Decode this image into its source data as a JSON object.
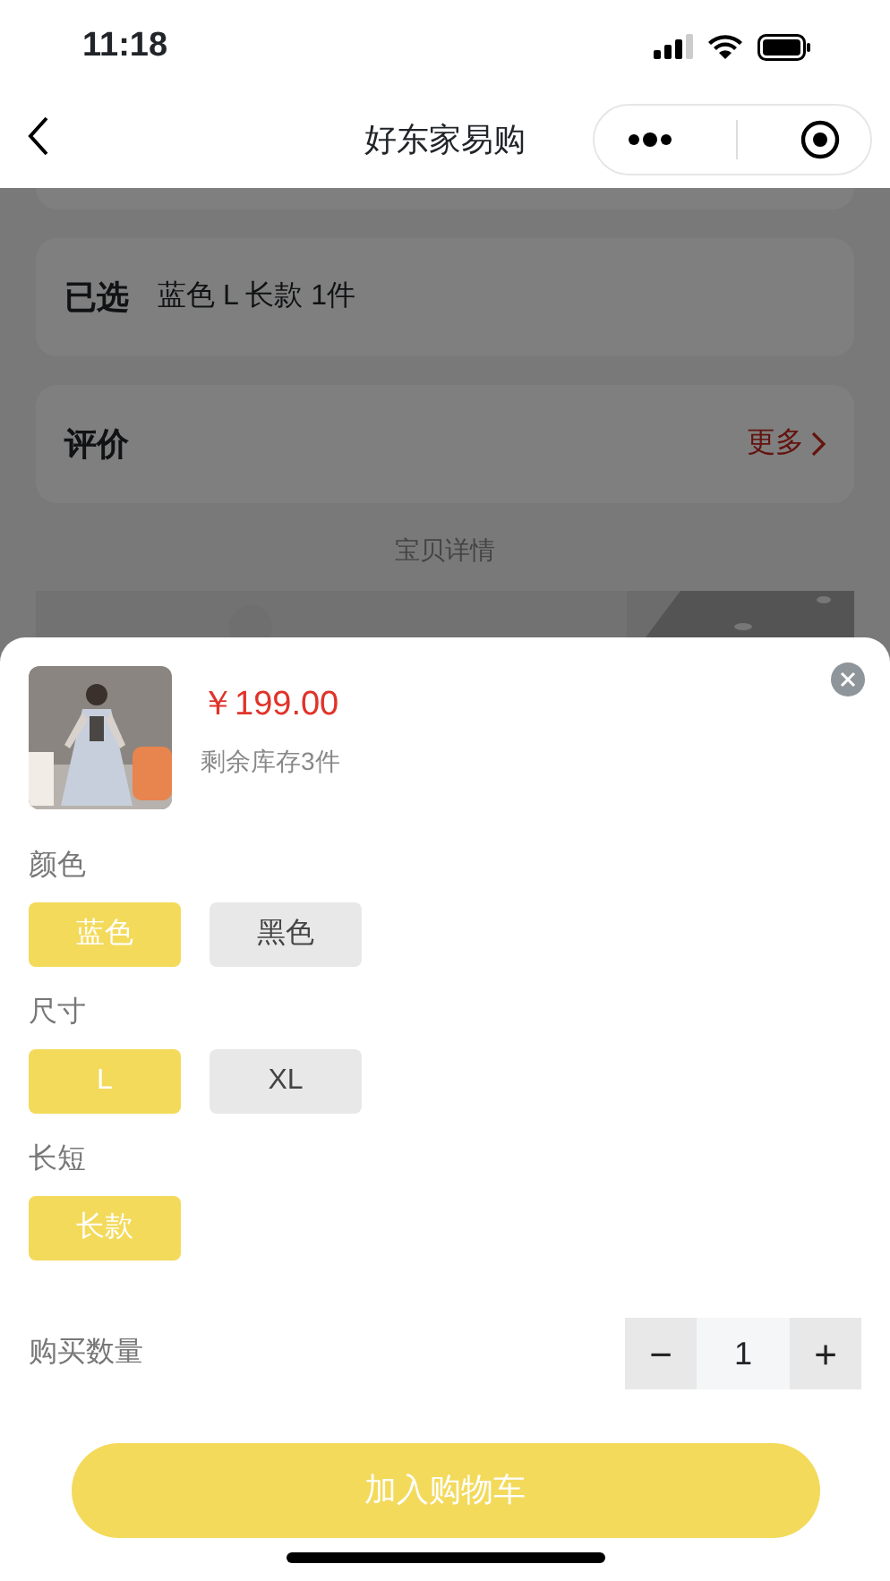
{
  "status_bar": {
    "time": "11:18"
  },
  "nav_bar": {
    "title": "好东家易购"
  },
  "background": {
    "selected_label": "已选",
    "selected_value": "蓝色 L 长款 1件",
    "reviews_label": "评价",
    "more_link": "更多",
    "details_heading": "宝贝详情",
    "dimmed": true
  },
  "sheet": {
    "price": "￥199.00",
    "stock": "剩余库存3件",
    "specs": [
      {
        "label": "颜色",
        "options": [
          {
            "label": "蓝色",
            "selected": true
          },
          {
            "label": "黑色",
            "selected": false
          }
        ]
      },
      {
        "label": "尺寸",
        "options": [
          {
            "label": "L",
            "selected": true
          },
          {
            "label": "XL",
            "selected": false
          }
        ]
      },
      {
        "label": "长短",
        "options": [
          {
            "label": "长款",
            "selected": true
          }
        ]
      }
    ],
    "quantity": {
      "label": "购买数量",
      "minus": "−",
      "value": "1",
      "plus": "+"
    },
    "add_to_cart": "加入购物车"
  }
}
